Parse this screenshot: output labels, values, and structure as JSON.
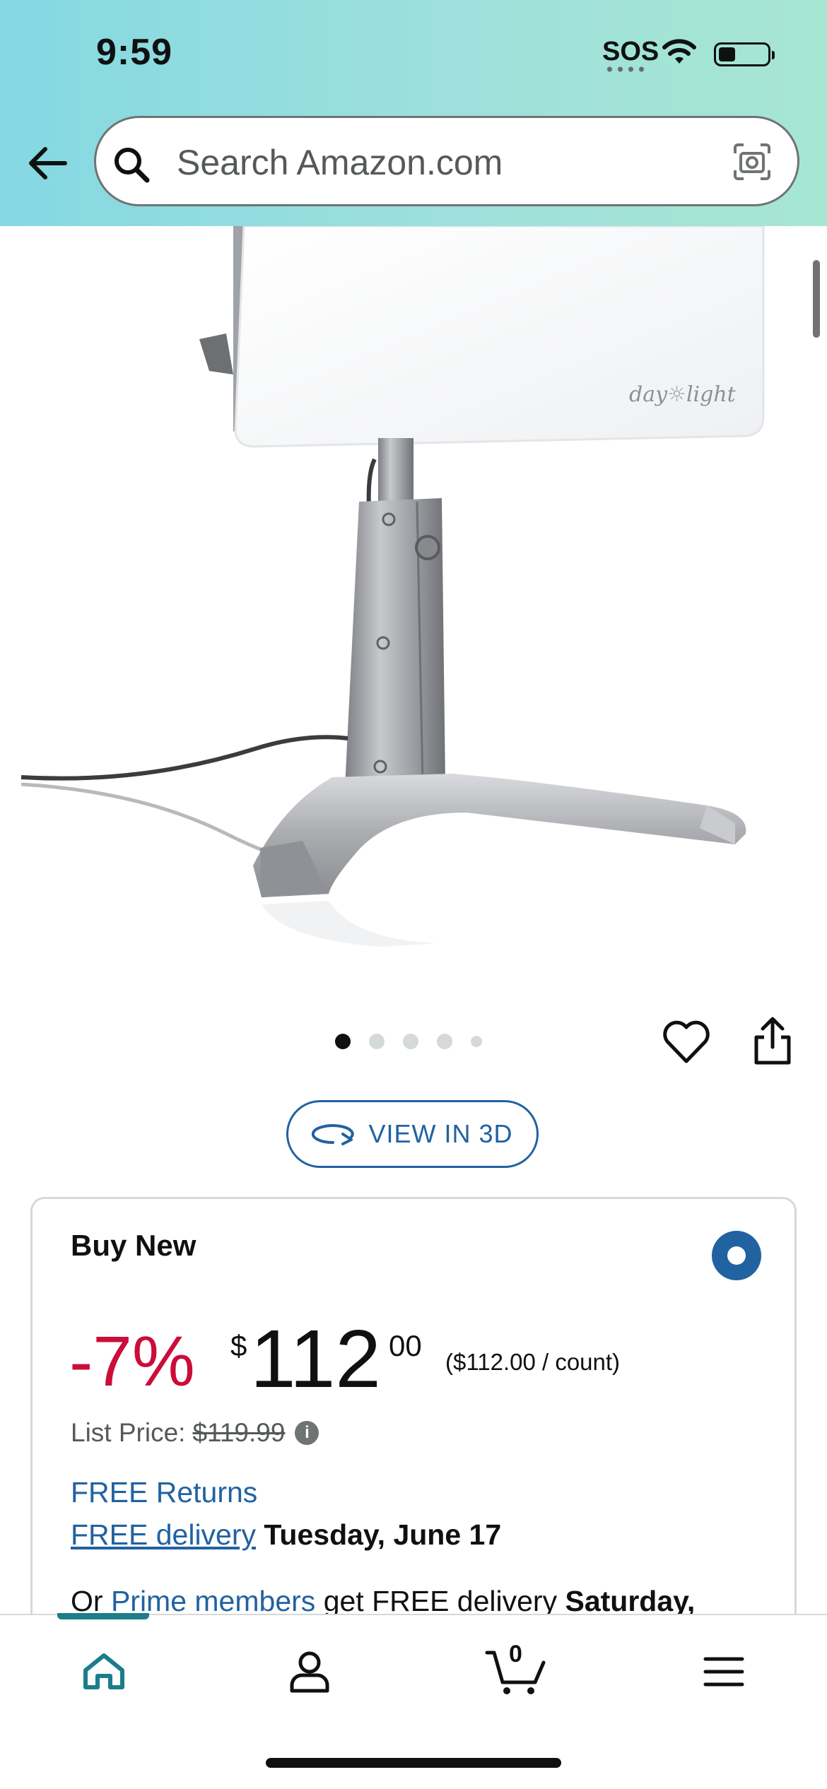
{
  "status_bar": {
    "time": "9:59",
    "sos": "SOS",
    "battery_level": 0.35
  },
  "header": {
    "back_icon": "back-arrow-icon",
    "search_placeholder": "Search Amazon.com",
    "search_icon": "search-icon",
    "camera_icon": "camera-icon"
  },
  "product_image": {
    "brand_mark": "day light",
    "carousel_count": 5,
    "carousel_active_index": 0
  },
  "actions": {
    "wishlist_icon": "heart-icon",
    "share_icon": "share-icon",
    "view_3d_label": "VIEW IN 3D"
  },
  "buy_box": {
    "title": "Buy New",
    "selected": true,
    "discount": "-7%",
    "price_symbol": "$",
    "price_whole": "112",
    "price_fraction": "00",
    "unit_price": "($112.00 / count)",
    "list_price_label": "List Price:",
    "list_price_value": "$119.99",
    "free_returns": "FREE Returns",
    "free_delivery_link": "FREE delivery",
    "delivery_date": "Tuesday, June 17",
    "prime_prefix": "Or",
    "prime_link": "Prime members",
    "prime_middle": "get FREE delivery",
    "prime_date": "Saturday,"
  },
  "tab_bar": {
    "items": [
      {
        "name": "home",
        "icon": "home-icon",
        "active": true
      },
      {
        "name": "account",
        "icon": "person-icon",
        "active": false
      },
      {
        "name": "cart",
        "icon": "cart-icon",
        "active": false
      },
      {
        "name": "menu",
        "icon": "hamburger-menu-icon",
        "active": false
      }
    ],
    "cart_count": "0"
  },
  "colors": {
    "header_gradient_start": "#84d8e2",
    "header_gradient_end": "#a7e6d3",
    "link_blue": "#2162a1",
    "discount_red": "#cc0c39",
    "tab_active_teal": "#1b7e8a"
  }
}
